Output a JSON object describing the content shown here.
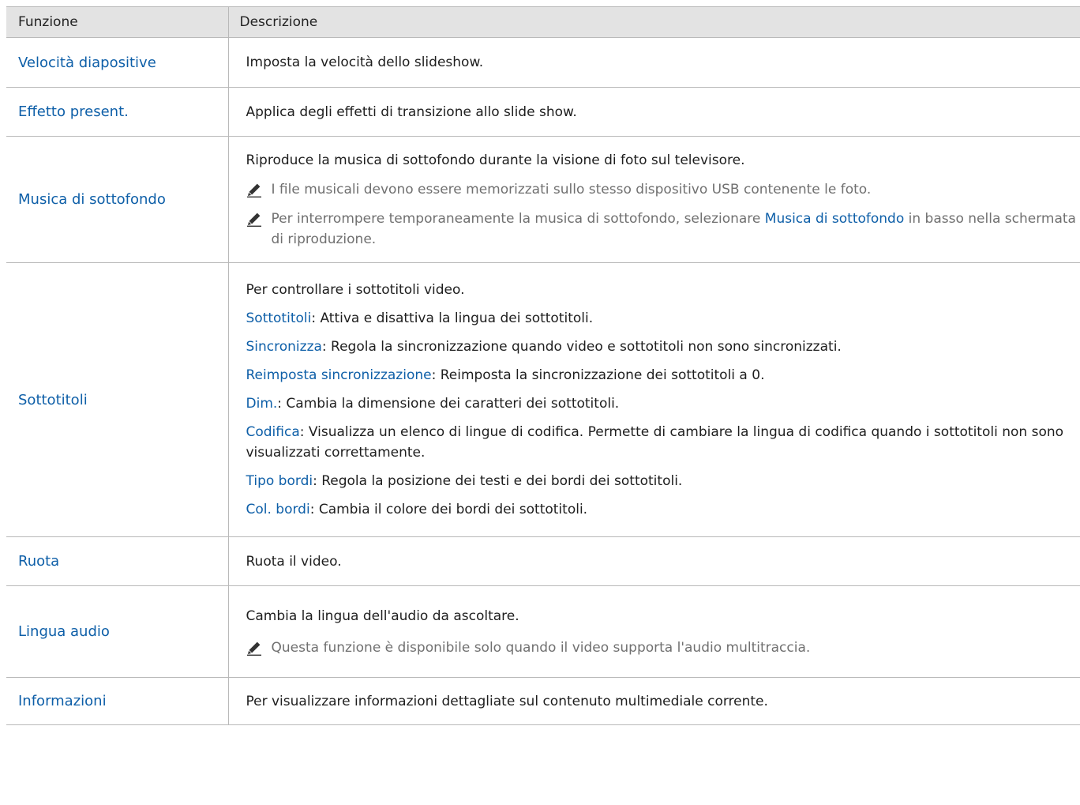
{
  "table": {
    "headers": {
      "function": "Funzione",
      "description": "Descrizione"
    },
    "rows": [
      {
        "name": "Velocità diapositive",
        "lines": [
          {
            "text": "Imposta la velocità dello slideshow."
          }
        ]
      },
      {
        "name": "Effetto present.",
        "lines": [
          {
            "text": "Applica degli effetti di transizione allo slide show."
          }
        ]
      },
      {
        "name": "Musica di sottofondo",
        "lines": [
          {
            "text": "Riproduce la musica di sottofondo durante la visione di foto sul televisore."
          }
        ],
        "notes": [
          {
            "text": "I file musicali devono essere memorizzati sullo stesso dispositivo USB contenente le foto."
          },
          {
            "pre": "Per interrompere temporaneamente la musica di sottofondo, selezionare ",
            "link": "Musica di sottofondo",
            "post": " in basso nella schermata di riproduzione."
          }
        ]
      },
      {
        "name": "Sottotitoli",
        "intro": "Per controllare i sottotitoli video.",
        "options": [
          {
            "term": "Sottotitoli",
            "desc": ": Attiva e disattiva la lingua dei sottotitoli."
          },
          {
            "term": "Sincronizza",
            "desc": ": Regola la sincronizzazione quando video e sottotitoli non sono sincronizzati."
          },
          {
            "term": "Reimposta sincronizzazione",
            "desc": ": Reimposta la sincronizzazione dei sottotitoli a 0."
          },
          {
            "term": "Dim.",
            "desc": ": Cambia la dimensione dei caratteri dei sottotitoli."
          },
          {
            "term": "Codifica",
            "desc": ": Visualizza un elenco di lingue di codifica. Permette di cambiare la lingua di codifica quando i sottotitoli non sono visualizzati correttamente."
          },
          {
            "term": "Tipo bordi",
            "desc": ": Regola la posizione dei testi e dei bordi dei sottotitoli."
          },
          {
            "term": "Col. bordi",
            "desc": ": Cambia il colore dei bordi dei sottotitoli."
          }
        ]
      },
      {
        "name": "Ruota",
        "lines": [
          {
            "text": "Ruota il video."
          }
        ]
      },
      {
        "name": "Lingua audio",
        "lines": [
          {
            "text": "Cambia la lingua dell'audio da ascoltare."
          }
        ],
        "notes": [
          {
            "text": "Questa funzione è disponibile solo quando il video supporta l'audio multitraccia."
          }
        ]
      },
      {
        "name": "Informazioni",
        "lines": [
          {
            "text": "Per visualizzare informazioni dettagliate sul contenuto multimediale corrente."
          }
        ]
      }
    ]
  },
  "colors": {
    "link": "#0e5fa8",
    "header_bg": "#e3e3e3",
    "note_text": "#707070",
    "border": "#b9b9b9"
  },
  "icons": {
    "note": "pencil-icon"
  }
}
